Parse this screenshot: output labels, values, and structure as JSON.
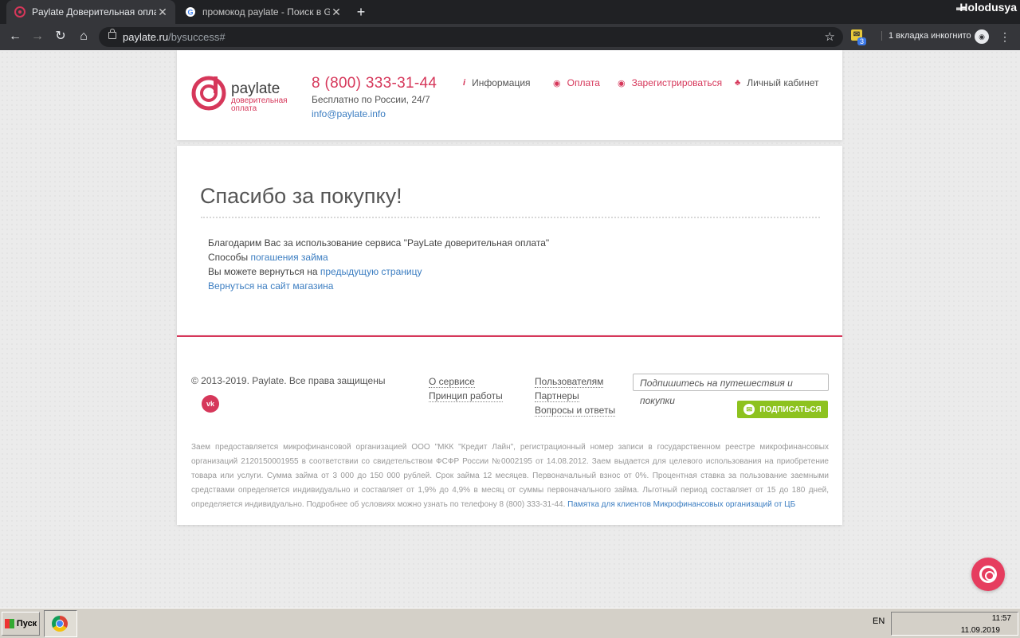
{
  "browser": {
    "tabs": [
      {
        "title": "Paylate Доверительная оплата",
        "active": true
      },
      {
        "title": "промокод paylate - Поиск в Google",
        "active": false
      }
    ],
    "window_user": "Holodusya",
    "url_host": "paylate.ru",
    "url_path": "/bysuccess#",
    "extension_badge": "3",
    "incognito_label": "1 вкладка инкогнито"
  },
  "header": {
    "logo_name": "paylate",
    "logo_sub": "доверительная оплата",
    "phone": "8 (800) 333-31-44",
    "free_call": "Бесплатно по России, 24/7",
    "email": "info@paylate.info",
    "nav": {
      "info": "Информация",
      "pay": "Оплата",
      "register": "Зарегистрироваться",
      "cabinet": "Личный кабинет"
    }
  },
  "main": {
    "title": "Спасибо за покупку!",
    "thanks": "Благодарим Вас за использование сервиса \"PayLate доверительная оплата\"",
    "methods_prefix": "Способы ",
    "methods_link": "погашения займа",
    "back_prefix": "Вы можете вернуться на ",
    "back_link": "предыдущую страницу",
    "shop_link": "Вернуться на сайт магазина"
  },
  "footer": {
    "copyright": "© 2013-2019. Paylate. Все права защищены",
    "vk_label": "vk",
    "col1": [
      "О сервисе",
      "Принцип работы"
    ],
    "col2": [
      "Пользователям",
      "Партнеры",
      "Вопросы и ответы"
    ],
    "subscribe_placeholder": "Подпишитесь на путешествия и покупки",
    "subscribe_button": "ПОДПИСАТЬСЯ",
    "disclaimer": "Заем предоставляется микрофинансовой организацией ООО \"МКК \"Кредит Лайн\", регистрационный номер записи в государственном реестре микрофинансовых организаций 2120150001955 в соответствии со свидетельством ФСФР России №0002195 от 14.08.2012. Заем выдается для целевого использования на приобретение товара или услуги. Сумма займа от 3 000 до 150 000 рублей. Срок займа 12 месяцев. Первоначальный взнос от 0%. Процентная ставка за пользование заемными средствами определяется индивидуально и составляет от 1,9% до 4,9% в месяц от суммы первоначального займа. Льготный период составляет от 15 до 180 дней, определяется индивидуально. Подробнее об условиях можно узнать по телефону 8 (800) 333-31-44. ",
    "disclaimer_link": "Памятка для клиентов Микрофинансовых организаций от ЦБ"
  },
  "taskbar": {
    "start_label": "Пуск",
    "lang": "EN",
    "time": "11:57",
    "date": "11.09.2019"
  },
  "colors": {
    "brand": "#d6375a",
    "link": "#3b7dc1",
    "subscribe": "#8dc21f"
  }
}
